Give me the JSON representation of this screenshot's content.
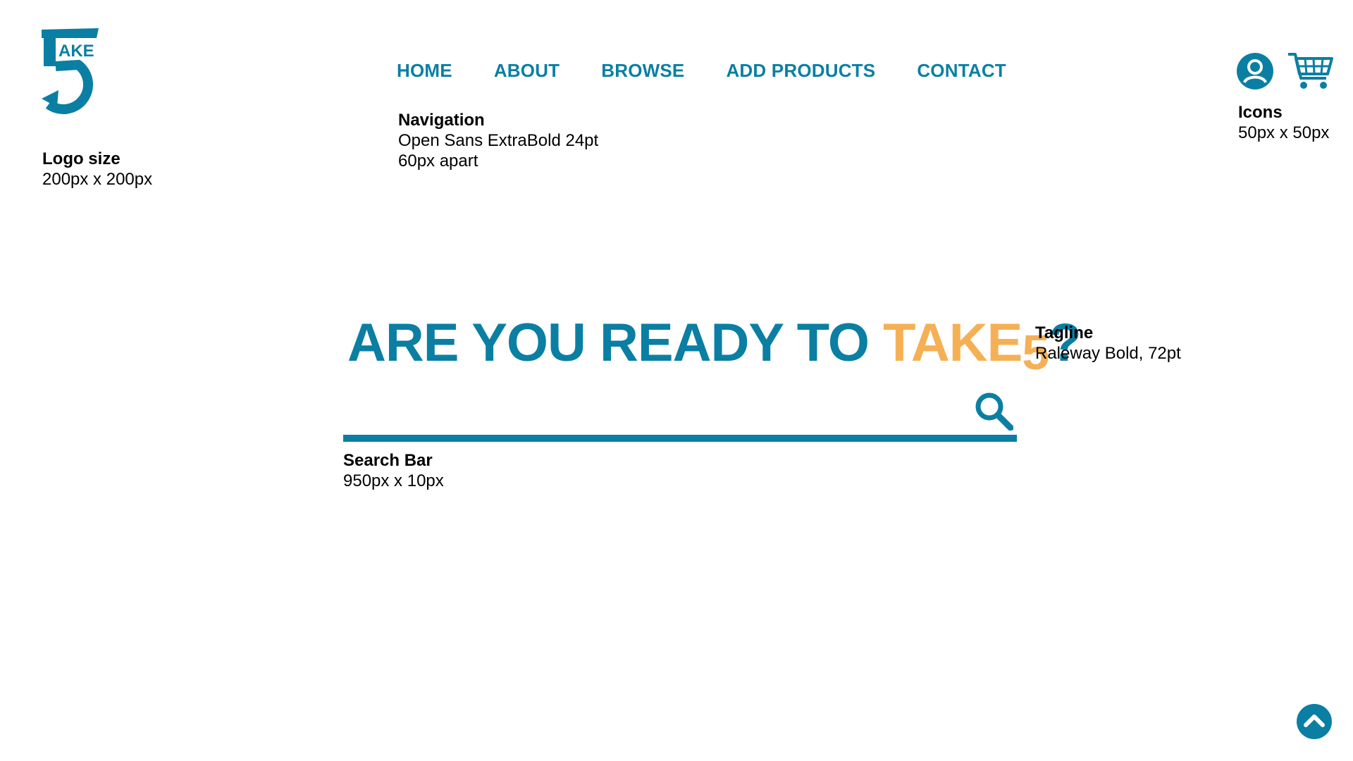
{
  "colors": {
    "brand": "#0a7fa3",
    "accent": "#f5b055",
    "text": "#000000"
  },
  "logo": {
    "text": "AKE",
    "icon": "take5-logo-icon"
  },
  "notes": {
    "logo": {
      "title": "Logo size",
      "detail": "200px x 200px"
    },
    "navigation": {
      "title": "Navigation",
      "line1": "Open Sans ExtraBold 24pt",
      "line2": "60px apart"
    },
    "icons": {
      "title": "Icons",
      "detail": "50px x 50px"
    },
    "tagline": {
      "title": "Tagline",
      "detail": "Raleway Bold, 72pt"
    },
    "search": {
      "title": "Search Bar",
      "detail": "950px x 10px"
    }
  },
  "nav": {
    "items": [
      {
        "label": "HOME"
      },
      {
        "label": "ABOUT"
      },
      {
        "label": "BROWSE"
      },
      {
        "label": "ADD PRODUCTS"
      },
      {
        "label": "CONTACT"
      }
    ]
  },
  "header_icons": {
    "account": "user-account-icon",
    "cart": "shopping-cart-icon"
  },
  "tagline": {
    "part1": "ARE YOU READY TO ",
    "accent": "TAKE",
    "five": "5",
    "end": "?"
  },
  "search": {
    "placeholder": "",
    "icon": "search-icon"
  },
  "back_to_top": {
    "icon": "chevron-up-icon"
  }
}
